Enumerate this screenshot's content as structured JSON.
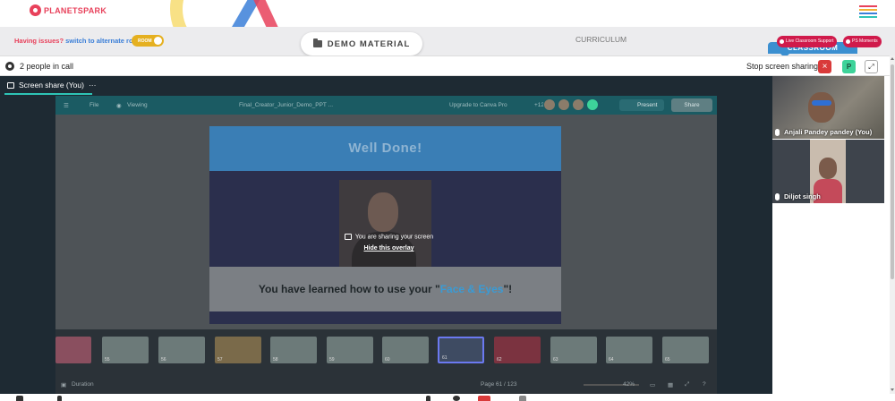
{
  "brand": {
    "logo_text": "PLANETSPARK",
    "accent": "#e8415b"
  },
  "nav": {
    "issues_text": "Having issues?",
    "switch_text": "switch to alternate room",
    "room_toggle_label": "ROOM",
    "demo_material_label": "DEMO MATERIAL",
    "curriculum_label": "CURRICULUM",
    "classroom_label": "CLASSROOM",
    "live_support_label": "Live Classroom Support",
    "ps_moments_label": "PS Moments"
  },
  "call": {
    "people_count": "2 people in call",
    "stop_sharing_label": "Stop screen sharing",
    "close_glyph": "×",
    "user_initial": "P",
    "expand_glyph": "⤢"
  },
  "share": {
    "label": "Screen share (You)",
    "more_glyph": "···"
  },
  "canva": {
    "file_label": "File",
    "viewing_label": "Viewing",
    "doc_title": "Final_Creator_Junior_Demo_PPT ...",
    "upgrade_label": "Upgrade to Canva Pro",
    "collab_count": "+12",
    "present_label": "Present",
    "share_label": "Share",
    "slide_title": "Well Done!",
    "sharing_notice": "You are sharing your screen",
    "hide_overlay": "Hide this overlay",
    "learned_prefix": "You have learned how to use your \"",
    "learned_highlight": "Face & Eyes",
    "learned_suffix": "\"!",
    "duration_label": "Duration",
    "page_indicator": "Page 61 / 123",
    "zoom_level": "42%",
    "help_glyph": "?"
  },
  "thumbnails": [
    "55",
    "56",
    "57",
    "58",
    "59",
    "60",
    "61",
    "62",
    "63",
    "64",
    "65"
  ],
  "participants": [
    {
      "name": "Anjali Pandey pandey (You)"
    },
    {
      "name": "Diljot singh"
    }
  ]
}
